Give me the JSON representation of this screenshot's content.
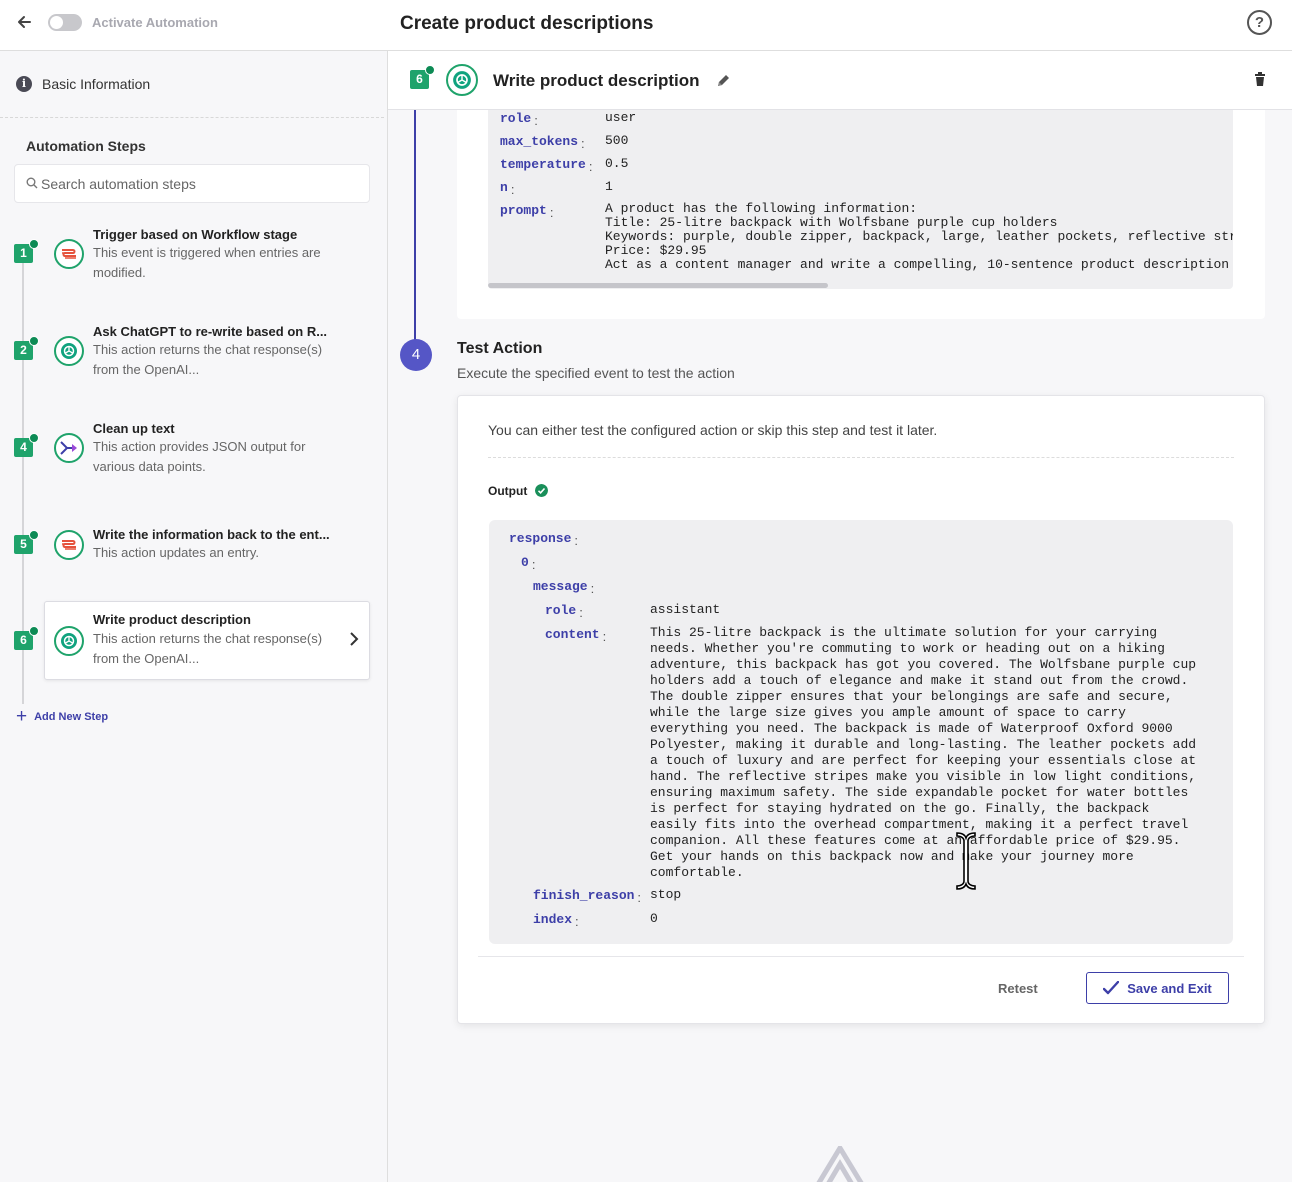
{
  "topbar": {
    "toggle_label": "Activate Automation",
    "page_title": "Create product descriptions",
    "help_glyph": "?"
  },
  "sidebar": {
    "basic_info": "Basic Information",
    "steps_heading": "Automation Steps",
    "search_placeholder": "Search automation steps",
    "steps": [
      {
        "number": "1",
        "title": "Trigger based on Workflow stage",
        "desc": "This event is triggered when entries are modified.",
        "icon": "stack-icon"
      },
      {
        "number": "2",
        "title": "Ask ChatGPT to re-write based on R...",
        "desc": "This action returns the chat response(s) from the OpenAI...",
        "icon": "openai-icon"
      },
      {
        "number": "4",
        "title": "Clean up text",
        "desc": "This action provides JSON output for various data points.",
        "icon": "transform-icon"
      },
      {
        "number": "5",
        "title": "Write the information back to the ent...",
        "desc": "This action updates an entry.",
        "icon": "stack-icon"
      },
      {
        "number": "6",
        "title": "Write product description",
        "desc": "This action returns the chat response(s) from the OpenAI...",
        "icon": "openai-icon"
      }
    ],
    "add_step": "Add New Step"
  },
  "main": {
    "header": {
      "number": "6",
      "title": "Write product description"
    },
    "config": {
      "rows": [
        {
          "key": "role",
          "value": "user"
        },
        {
          "key": "max_tokens",
          "value": "500"
        },
        {
          "key": "temperature",
          "value": "0.5"
        },
        {
          "key": "n",
          "value": "1"
        },
        {
          "key": "prompt",
          "value": "A product has the following information:\nTitle: 25-litre backpack with Wolfsbane purple cup holders\nKeywords: purple, double zipper, backpack, large, leather pockets, reflective str\nPrice: $29.95\nAct as a content manager and write a compelling, 10-sentence product description"
        }
      ]
    },
    "test": {
      "step_number": "4",
      "title": "Test Action",
      "subtitle": "Execute the specified event to test the action",
      "intro": "You can either test the configured action or skip this step and test it later.",
      "output_label": "Output",
      "output": {
        "response_key": "response",
        "index_key": "0",
        "message_key": "message",
        "role_key": "role",
        "role_value": "assistant",
        "content_key": "content",
        "content_value": "This 25-litre backpack is the ultimate solution for your carrying\nneeds. Whether you're commuting to work or heading out on a hiking\nadventure, this backpack has got you covered. The Wolfsbane purple cup\nholders add a touch of elegance and make it stand out from the crowd.\nThe double zipper ensures that your belongings are safe and secure,\nwhile the large size gives you ample amount of space to carry\neverything you need. The backpack is made of Waterproof Oxford 9000\nPolyester, making it durable and long-lasting. The leather pockets add\na touch of luxury and are perfect for keeping your essentials close at\nhand. The reflective stripes make you visible in low light conditions,\nensuring maximum safety. The side expandable pocket for water bottles\nis perfect for staying hydrated on the go. Finally, the backpack\neasily fits into the overhead compartment, making it a perfect travel\ncompanion. All these features come at an affordable price of $29.95.\nGet your hands on this backpack now and make your journey more\ncomfortable.",
        "finish_reason_key": "finish_reason",
        "finish_reason_value": "stop",
        "index2_key": "index",
        "index2_value": "0"
      },
      "retest_label": "Retest",
      "save_label": "Save and Exit"
    }
  },
  "colors": {
    "accent": "#3d3fa8",
    "step_green": "#1fa36b",
    "step_circle": "#5556c6"
  }
}
